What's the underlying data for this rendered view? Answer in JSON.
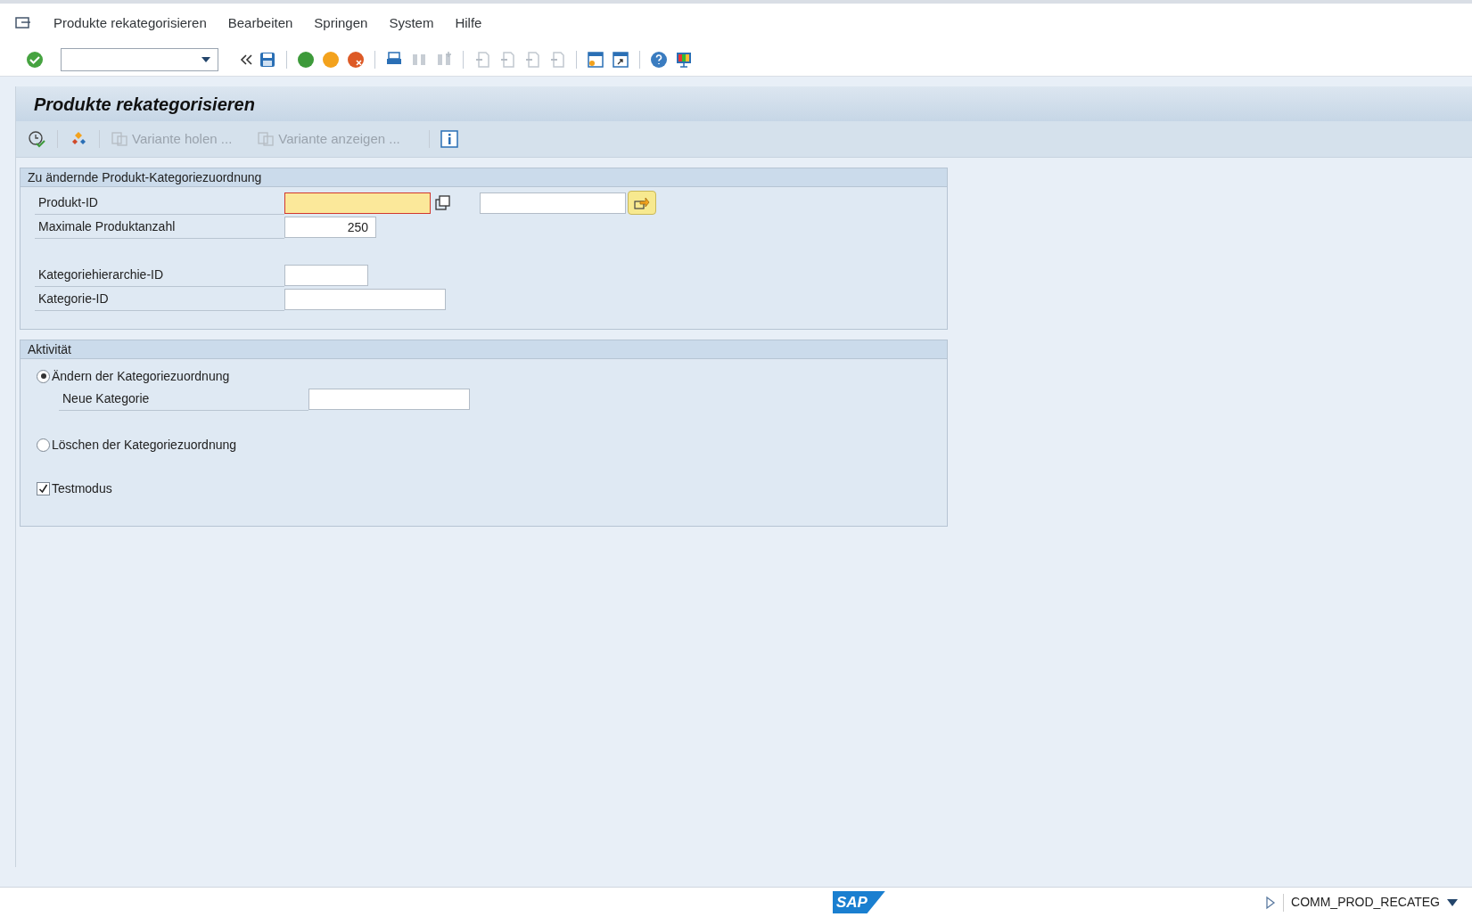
{
  "menu": [
    {
      "label": "Produkte rekategorisieren"
    },
    {
      "label": "Bearbeiten"
    },
    {
      "label": "Springen"
    },
    {
      "label": "System"
    },
    {
      "label": "Hilfe"
    }
  ],
  "title": "Produkte rekategorisieren",
  "app_toolbar": [
    {
      "label": "Variante holen ...",
      "disabled": true
    },
    {
      "label": "Variante anzeigen ...",
      "disabled": true
    }
  ],
  "group1": {
    "title": "Zu ändernde Produkt-Kategoriezuordnung",
    "fields": [
      {
        "kind": "range",
        "label": "Produkt-ID",
        "focused": true
      },
      {
        "kind": "single",
        "label": "Maximale Produktanzahl",
        "value": "250",
        "focused": false
      },
      {
        "kind": "single",
        "label": "Kategoriehierarchie-ID",
        "focused": false
      },
      {
        "kind": "single",
        "label": "Kategorie-ID",
        "focused": false
      }
    ]
  },
  "group2": {
    "title": "Aktivität",
    "options": [
      {
        "kind": "radio",
        "label": "Ändern der Kategoriezuordnung",
        "selected": true,
        "sub_field": {
          "label": "Neue Kategorie"
        }
      },
      {
        "kind": "radio",
        "label": "Löschen der Kategoriezuordnung",
        "selected": false
      },
      {
        "kind": "checkbox",
        "label": "Testmodus",
        "checked": true
      }
    ]
  },
  "status_bar": {
    "logo": "SAP",
    "transaction": "COMM_PROD_RECATEG"
  }
}
